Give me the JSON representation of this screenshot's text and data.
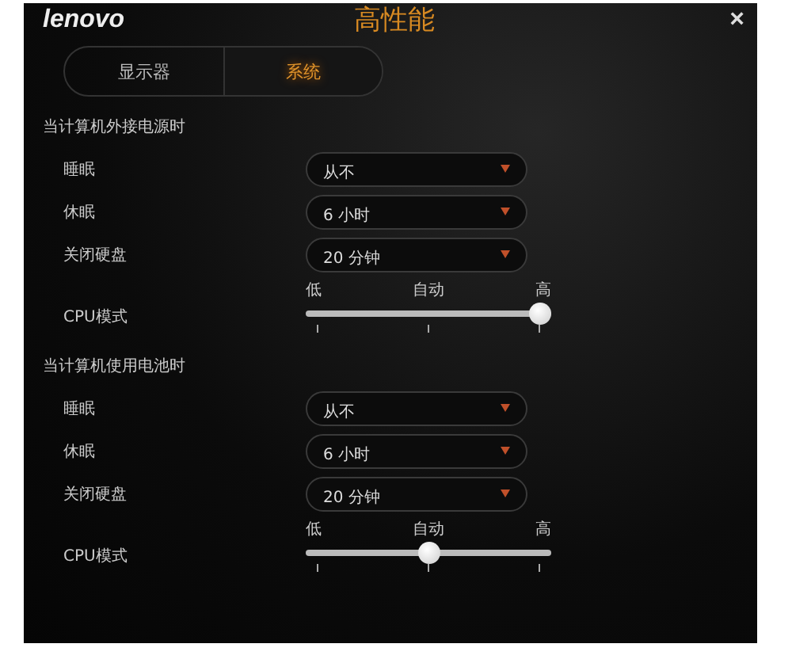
{
  "window": {
    "logo": "lenovo",
    "title": "高性能",
    "close": "×"
  },
  "tabs": [
    {
      "label": "显示器",
      "selected": false
    },
    {
      "label": "系统",
      "selected": true
    }
  ],
  "sections": [
    {
      "heading": "当计算机外接电源时",
      "rows": [
        {
          "label": "睡眠",
          "value": "从不"
        },
        {
          "label": "休眠",
          "value": "6 小时"
        },
        {
          "label": "关闭硬盘",
          "value": "20 分钟"
        }
      ],
      "cpu": {
        "label": "CPU模式",
        "marks": [
          "低",
          "自动",
          "高"
        ],
        "level": 1
      }
    },
    {
      "heading": "当计算机使用电池时",
      "rows": [
        {
          "label": "睡眠",
          "value": "从不"
        },
        {
          "label": "休眠",
          "value": "6 小时"
        },
        {
          "label": "关闭硬盘",
          "value": "20 分钟"
        }
      ],
      "cpu": {
        "label": "CPU模式",
        "marks": [
          "低",
          "自动",
          "高"
        ],
        "level": 0.5
      }
    }
  ]
}
